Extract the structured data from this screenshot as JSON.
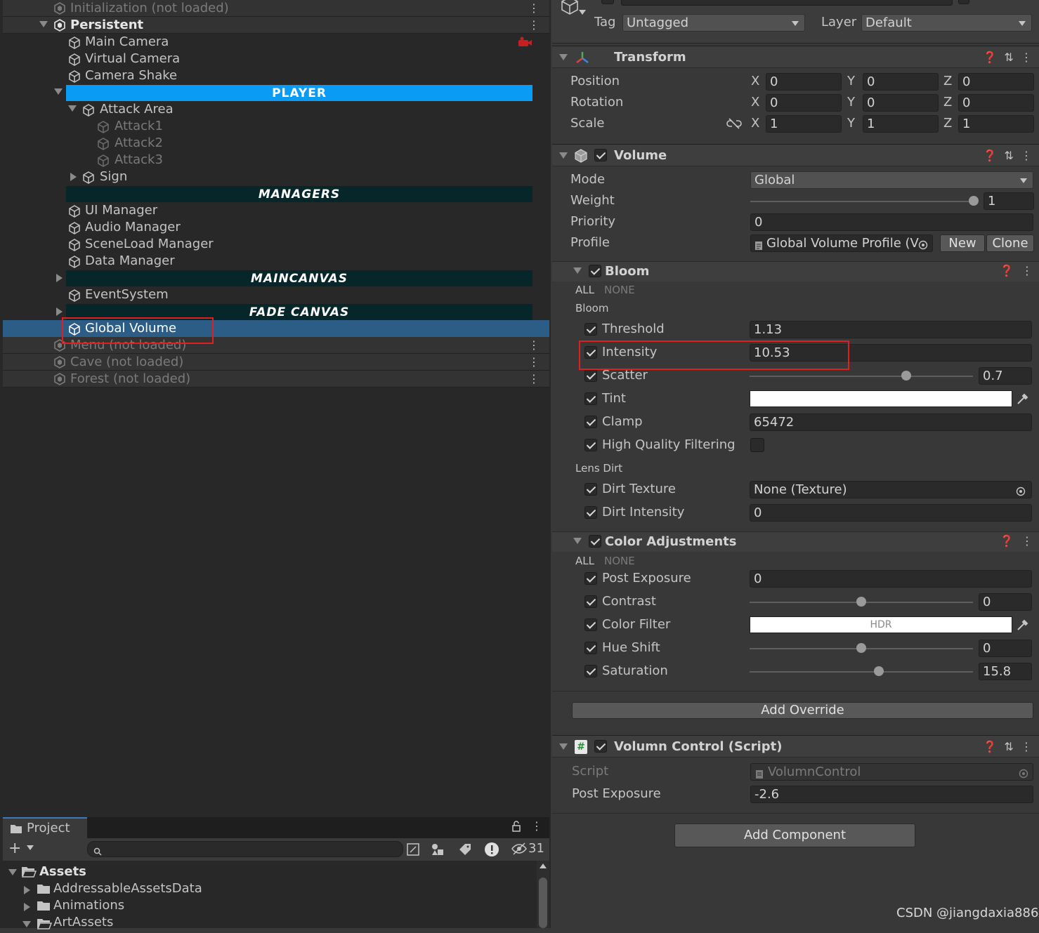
{
  "hierarchy": {
    "scenes": {
      "initialization": "Initialization (not loaded)",
      "persistent": "Persistent",
      "menu": "Menu (not loaded)",
      "cave": "Cave (not loaded)",
      "forest": "Forest (not loaded)"
    },
    "objects": {
      "main_camera": "Main Camera",
      "virtual_camera": "Virtual Camera",
      "camera_shake": "Camera Shake",
      "attack_area": "Attack Area",
      "attack1": "Attack1",
      "attack2": "Attack2",
      "attack3": "Attack3",
      "sign": "Sign",
      "ui_manager": "UI Manager",
      "audio_manager": "Audio Manager",
      "sceneload_manager": "SceneLoad Manager",
      "data_manager": "Data Manager",
      "event_system": "EventSystem",
      "global_volume": "Global Volume"
    },
    "headers": {
      "player": "PLAYER",
      "managers": "MANAGERS",
      "maincanvas": "MAINCANVAS",
      "fade_canvas": "FADE CANVAS"
    },
    "colors": {
      "player_header": "#0a9bf5",
      "dark_header": "#062629",
      "selection": "#2c5d87"
    }
  },
  "project": {
    "tab": "Project",
    "hidden_count": "31",
    "tree": {
      "assets": "Assets",
      "addressable": "AddressableAssetsData",
      "animations": "Animations",
      "artassets": "ArtAssets"
    }
  },
  "inspector": {
    "tag_label": "Tag",
    "tag_value": "Untagged",
    "layer_label": "Layer",
    "layer_value": "Default",
    "transform": {
      "title": "Transform",
      "position": {
        "label": "Position",
        "x": "0",
        "y": "0",
        "z": "0"
      },
      "rotation": {
        "label": "Rotation",
        "x": "0",
        "y": "0",
        "z": "0"
      },
      "scale": {
        "label": "Scale",
        "x": "1",
        "y": "1",
        "z": "1"
      },
      "axis_x": "X",
      "axis_y": "Y",
      "axis_z": "Z"
    },
    "volume": {
      "title": "Volume",
      "mode_label": "Mode",
      "mode_value": "Global",
      "weight_label": "Weight",
      "weight_value": "1",
      "weight_fraction": 1.0,
      "priority_label": "Priority",
      "priority_value": "0",
      "profile_label": "Profile",
      "profile_value": "Global Volume Profile (V",
      "new_btn": "New",
      "clone_btn": "Clone"
    },
    "bloom": {
      "title": "Bloom",
      "all": "ALL",
      "none": "NONE",
      "section": "Bloom",
      "threshold_label": "Threshold",
      "threshold_value": "1.13",
      "intensity_label": "Intensity",
      "intensity_value": "10.53",
      "scatter_label": "Scatter",
      "scatter_value": "0.7",
      "scatter_fraction": 0.7,
      "tint_label": "Tint",
      "clamp_label": "Clamp",
      "clamp_value": "65472",
      "hq_label": "High Quality Filtering",
      "lens_dirt": "Lens Dirt",
      "dirt_texture_label": "Dirt Texture",
      "dirt_texture_value": "None (Texture)",
      "dirt_intensity_label": "Dirt Intensity",
      "dirt_intensity_value": "0"
    },
    "color_adjustments": {
      "title": "Color Adjustments",
      "all": "ALL",
      "none": "NONE",
      "post_exposure_label": "Post Exposure",
      "post_exposure_value": "0",
      "contrast_label": "Contrast",
      "contrast_value": "0",
      "contrast_fraction": 0.5,
      "color_filter_label": "Color Filter",
      "color_filter_hdr": "HDR",
      "hue_shift_label": "Hue Shift",
      "hue_shift_value": "0",
      "hue_shift_fraction": 0.5,
      "saturation_label": "Saturation",
      "saturation_value": "15.8",
      "saturation_fraction": 0.579
    },
    "add_override": "Add Override",
    "volumn_control": {
      "title": "Volumn Control (Script)",
      "script_label": "Script",
      "script_value": "VolumnControl",
      "post_exposure_label": "Post Exposure",
      "post_exposure_value": "-2.6"
    },
    "add_component": "Add Component"
  },
  "watermark": "CSDN @jiangdaxia886"
}
